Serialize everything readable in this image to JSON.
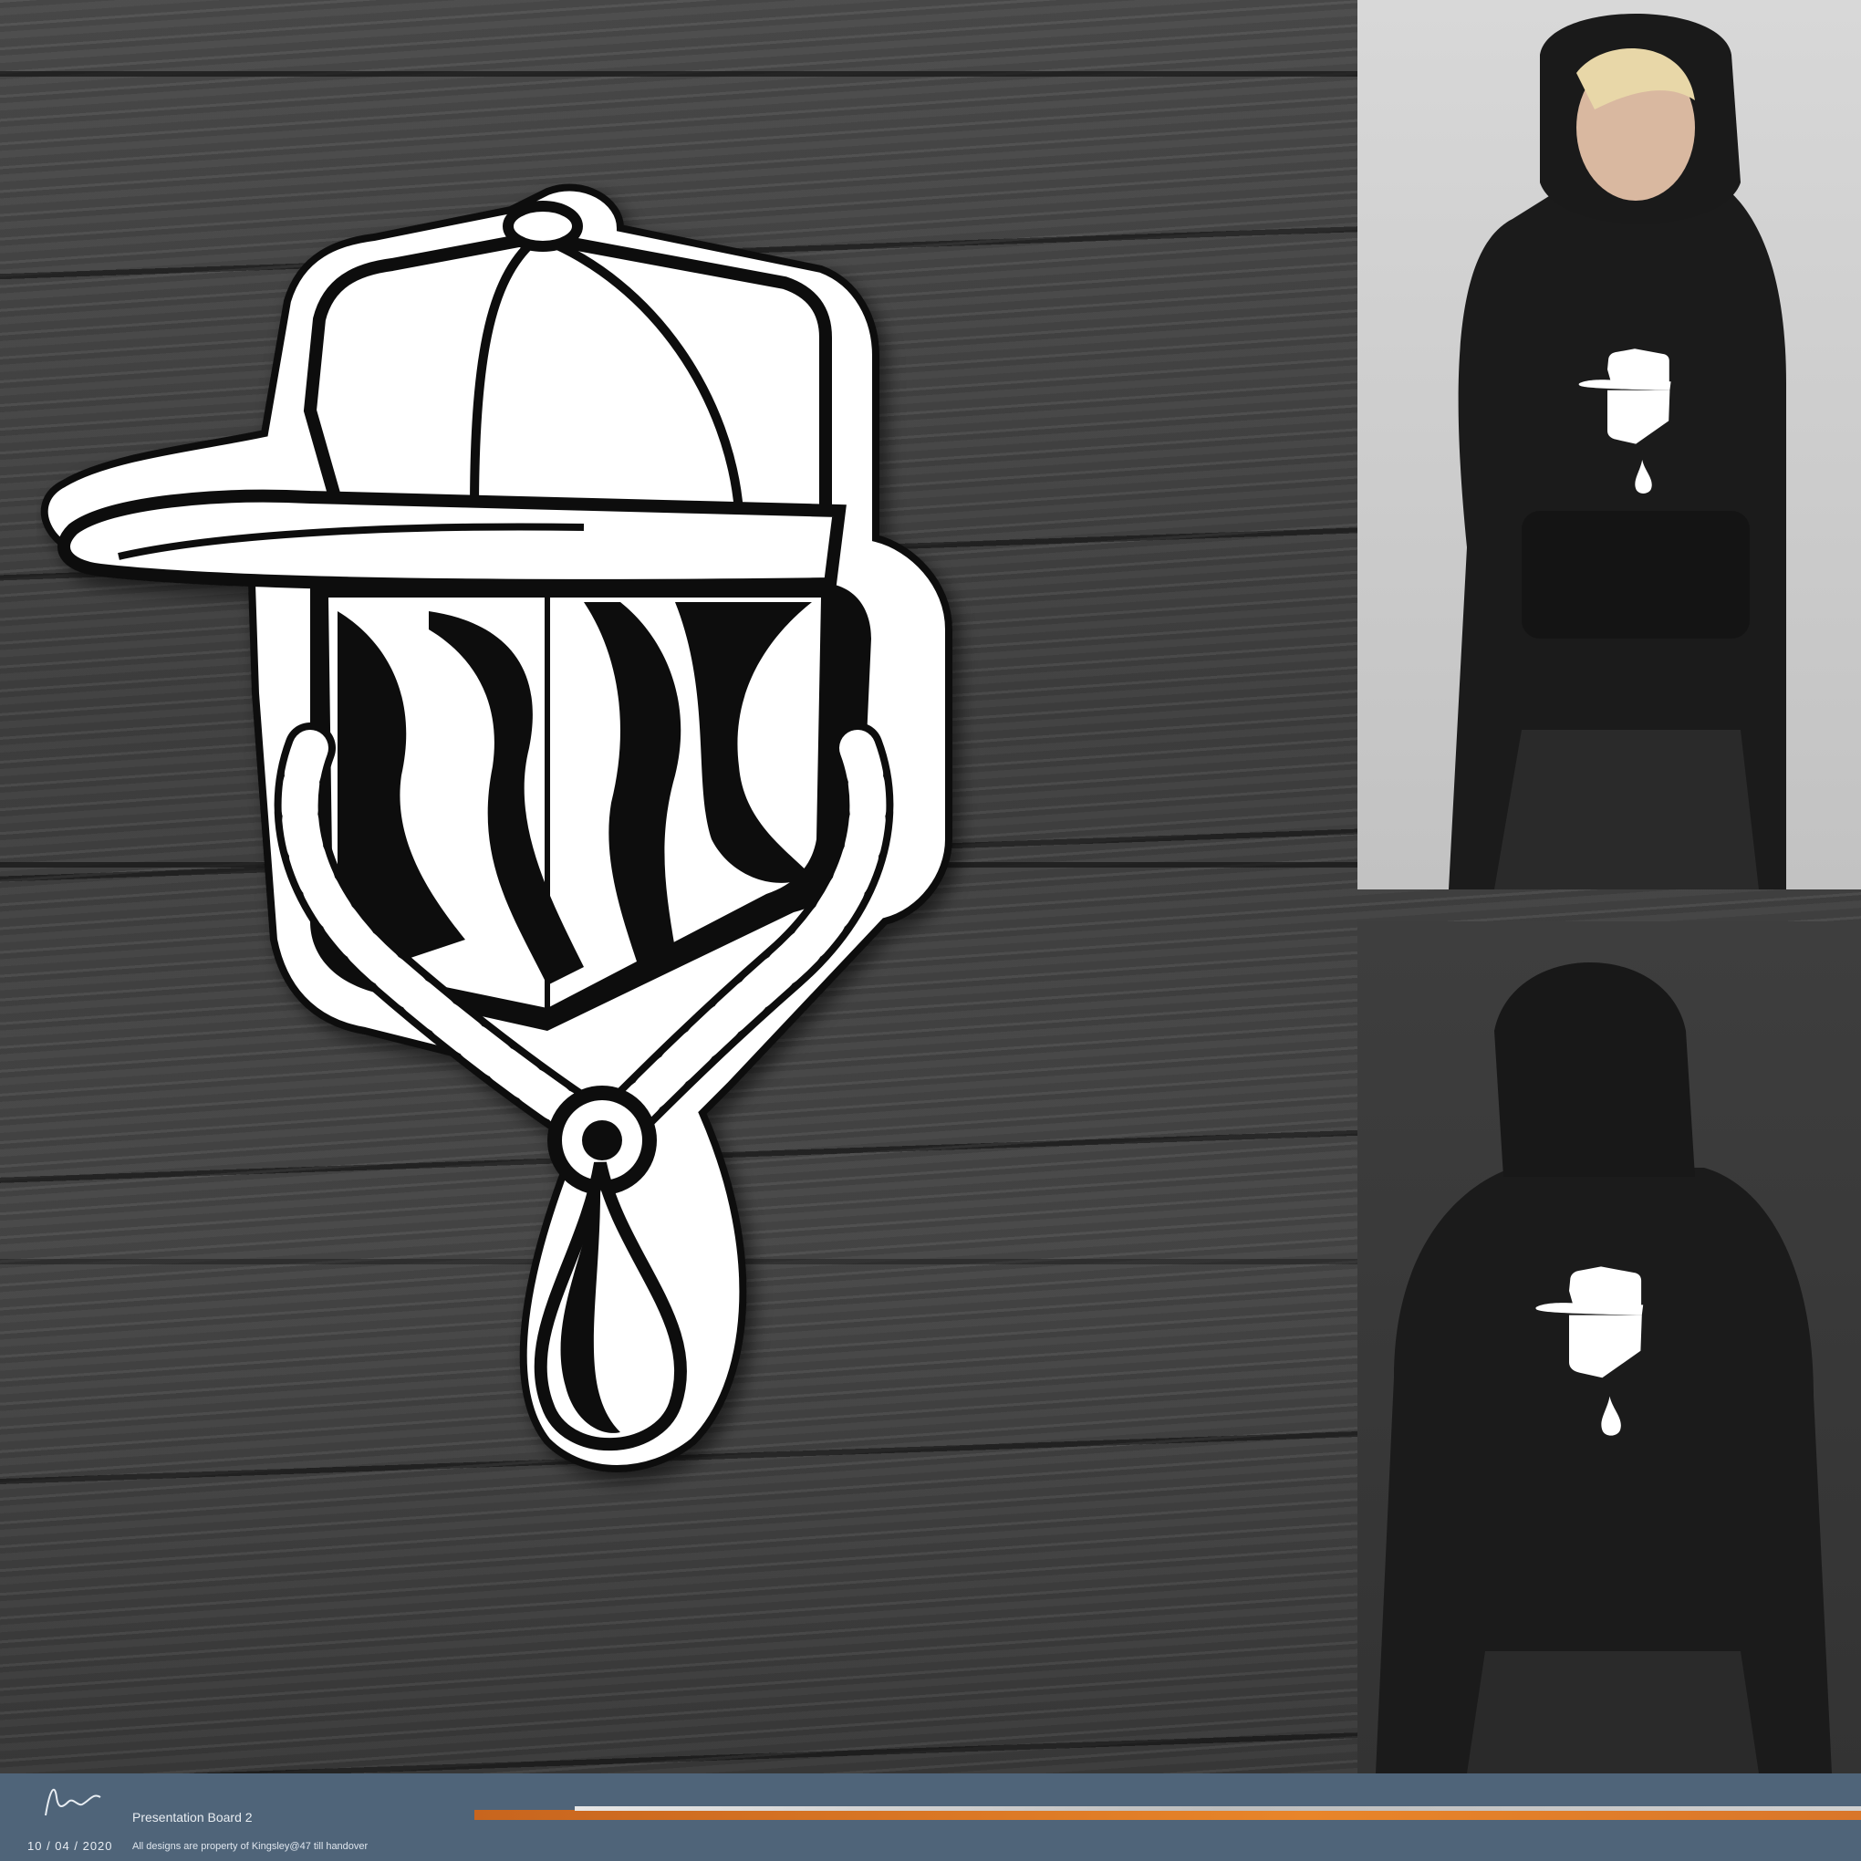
{
  "footer": {
    "date": "10 / 04 / 2020",
    "title": "Presentation Board 2",
    "rights": "All designs are property of Kingsley@47 till handover"
  },
  "colors": {
    "footer_bg": "#4f6479",
    "accent_orange": "#e8852a",
    "wood": "#444444"
  },
  "icons": [
    "signature",
    "cap-head-logo",
    "hoodie-front-photo",
    "hoodie-back-photo"
  ]
}
